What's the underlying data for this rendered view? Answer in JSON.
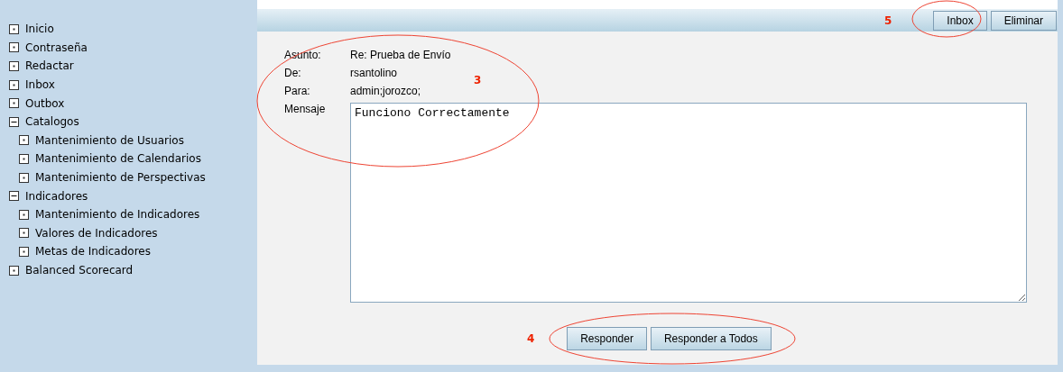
{
  "sidebar": {
    "items": [
      {
        "label": "Inicio",
        "kind": "leaf"
      },
      {
        "label": "Contraseña",
        "kind": "leaf"
      },
      {
        "label": "Redactar",
        "kind": "leaf"
      },
      {
        "label": "Inbox",
        "kind": "leaf"
      },
      {
        "label": "Outbox",
        "kind": "leaf"
      },
      {
        "label": "Catalogos",
        "kind": "folder",
        "expanded": true,
        "children": [
          {
            "label": "Mantenimiento de Usuarios",
            "kind": "leaf"
          },
          {
            "label": "Mantenimiento de Calendarios",
            "kind": "leaf"
          },
          {
            "label": "Mantenimiento de Perspectivas",
            "kind": "leaf"
          }
        ]
      },
      {
        "label": "Indicadores",
        "kind": "folder",
        "expanded": true,
        "children": [
          {
            "label": "Mantenimiento de Indicadores",
            "kind": "leaf"
          },
          {
            "label": "Valores de Indicadores",
            "kind": "leaf"
          },
          {
            "label": "Metas de Indicadores",
            "kind": "leaf"
          }
        ]
      },
      {
        "label": "Balanced Scorecard",
        "kind": "leaf"
      }
    ]
  },
  "toolbar": {
    "buttons": [
      "Inbox",
      "Eliminar"
    ]
  },
  "message": {
    "fields": [
      {
        "label": "Asunto:",
        "value": "Re: Prueba de Envío"
      },
      {
        "label": "De:",
        "value": "rsantolino"
      },
      {
        "label": "Para:",
        "value": "admin;jorozco;"
      }
    ],
    "body_label": "Mensaje",
    "body": "Funciono Correctamente"
  },
  "actions": {
    "buttons": [
      "Responder",
      "Responder a Todos"
    ]
  },
  "annotations": [
    "3",
    "4",
    "5"
  ]
}
